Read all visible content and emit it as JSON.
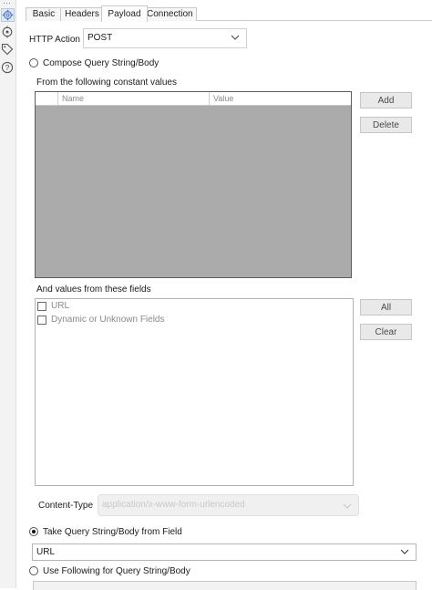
{
  "tabs": [
    {
      "label": "Basic"
    },
    {
      "label": "Headers"
    },
    {
      "label": "Payload"
    },
    {
      "label": "Connection"
    }
  ],
  "active_tab": "Payload",
  "http_action": {
    "label": "HTTP Action",
    "value": "POST"
  },
  "compose": {
    "label": "Compose Query String/Body",
    "constants_label": "From the following constant values",
    "columns": [
      "Name",
      "Value"
    ],
    "add_label": "Add",
    "delete_label": "Delete",
    "fields_label": "And values from these fields",
    "fields": [
      {
        "label": "URL",
        "checked": false
      },
      {
        "label": "Dynamic or Unknown Fields",
        "checked": false
      }
    ],
    "all_label": "All",
    "clear_label": "Clear",
    "content_type_label": "Content-Type",
    "content_type_value": "application/x-www-form-urlencoded"
  },
  "take_from_field": {
    "label": "Take Query String/Body from Field",
    "value": "URL",
    "selected": true
  },
  "use_following": {
    "label": "Use Following for Query String/Body",
    "selected": false
  },
  "icons": [
    "gear-icon",
    "target-icon",
    "tag-icon",
    "help-icon"
  ],
  "colors": {
    "grid_fill": "#ababab",
    "button_bg": "#e9e9e9",
    "border": "#c9c9c9"
  }
}
